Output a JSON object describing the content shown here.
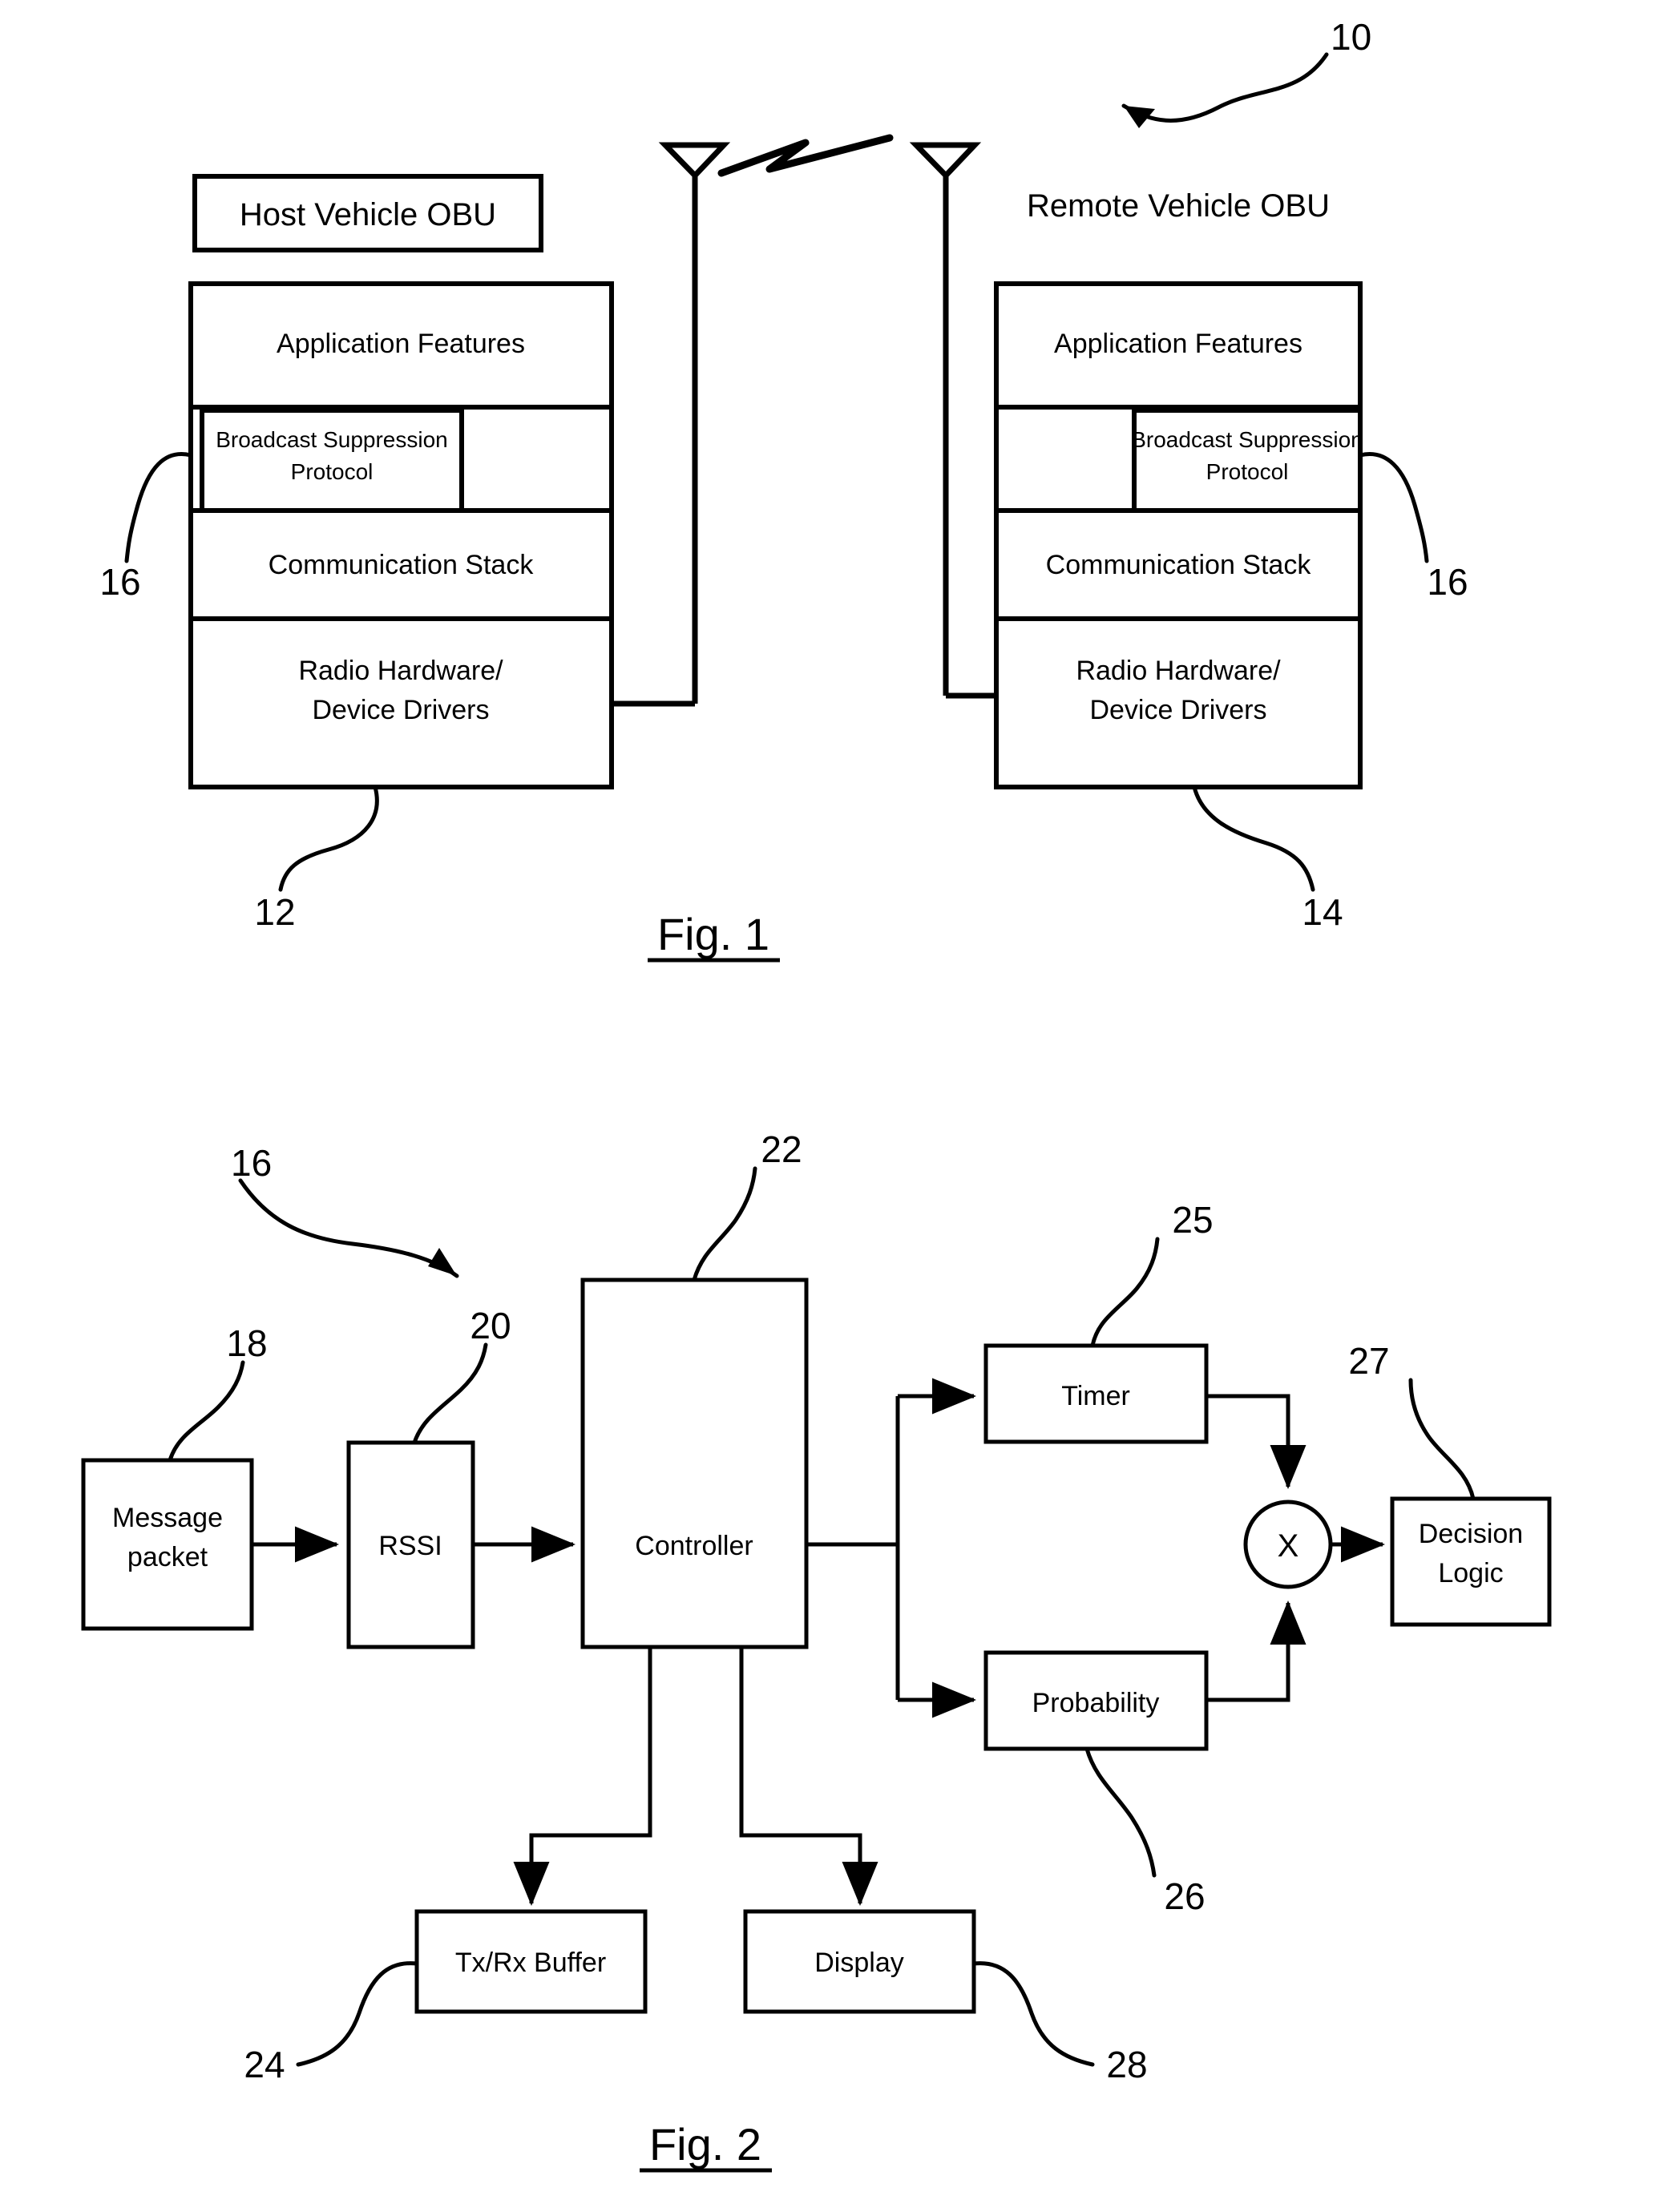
{
  "figure1": {
    "caption": "Fig. 1",
    "system_ref": "10",
    "host": {
      "title": "Host Vehicle OBU",
      "ref": "12",
      "protocol_ref": "16",
      "layers": [
        "Application Features",
        "Communication Stack",
        "Radio Hardware/",
        "Device Drivers"
      ],
      "protocol_label_line1": "Broadcast Suppression",
      "protocol_label_line2": "Protocol"
    },
    "remote": {
      "title": "Remote Vehicle OBU",
      "ref": "14",
      "protocol_ref": "16",
      "layers": [
        "Application Features",
        "Communication Stack",
        "Radio Hardware/",
        "Device Drivers"
      ],
      "protocol_label_line1": "Broadcast Suppression",
      "protocol_label_line2": "Protocol"
    },
    "antenna_left_name": "antenna-icon",
    "antenna_right_name": "antenna-icon",
    "rf_link_name": "rf-signal-icon"
  },
  "figure2": {
    "caption": "Fig. 2",
    "protocol_ref": "16",
    "blocks": {
      "message_packet_line1": "Message",
      "message_packet_line2": "packet",
      "message_packet_ref": "18",
      "rssi": "RSSI",
      "rssi_ref": "20",
      "controller": "Controller",
      "controller_ref": "22",
      "timer": "Timer",
      "timer_ref": "25",
      "probability": "Probability",
      "probability_ref": "26",
      "multiplier": "X",
      "decision_logic_line1": "Decision",
      "decision_logic_line2": "Logic",
      "decision_logic_ref": "27",
      "tx_rx_buffer": "Tx/Rx Buffer",
      "tx_rx_buffer_ref": "24",
      "display": "Display",
      "display_ref": "28"
    }
  },
  "style": {
    "ink": "#000000",
    "paper": "#ffffff"
  }
}
